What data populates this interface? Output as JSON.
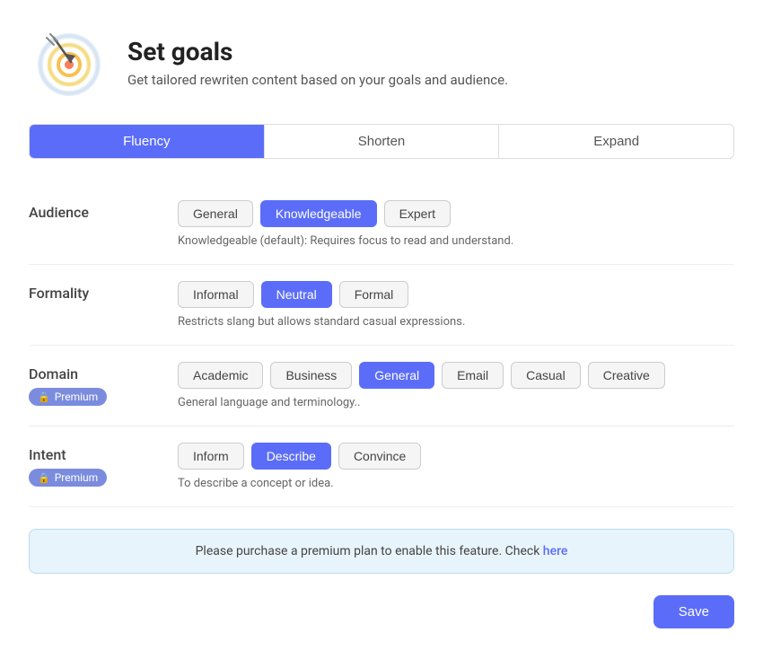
{
  "header": {
    "title": "Set goals",
    "subtitle": "Get tailored rewriten content based on your goals and audience."
  },
  "tabs": [
    {
      "label": "Fluency",
      "active": true
    },
    {
      "label": "Shorten",
      "active": false
    },
    {
      "label": "Expand",
      "active": false
    }
  ],
  "sections": {
    "audience": {
      "label": "Audience",
      "options": [
        "General",
        "Knowledgeable",
        "Expert"
      ],
      "selected": "Knowledgeable",
      "description": "Knowledgeable (default): Requires focus to read and understand."
    },
    "formality": {
      "label": "Formality",
      "options": [
        "Informal",
        "Neutral",
        "Formal"
      ],
      "selected": "Neutral",
      "description": "Restricts slang but allows standard casual expressions."
    },
    "domain": {
      "label": "Domain",
      "premium": true,
      "premium_label": "Premium",
      "options": [
        "Academic",
        "Business",
        "General",
        "Email",
        "Casual",
        "Creative"
      ],
      "selected": "General",
      "description": "General language and terminology.."
    },
    "intent": {
      "label": "Intent",
      "premium": true,
      "premium_label": "Premium",
      "options": [
        "Inform",
        "Describe",
        "Convince"
      ],
      "selected": "Describe",
      "description": "To describe a concept or idea."
    }
  },
  "premium_notice": {
    "text": "Please purchase a premium plan to enable this feature. Check",
    "link_text": "here"
  },
  "save_button": "Save"
}
